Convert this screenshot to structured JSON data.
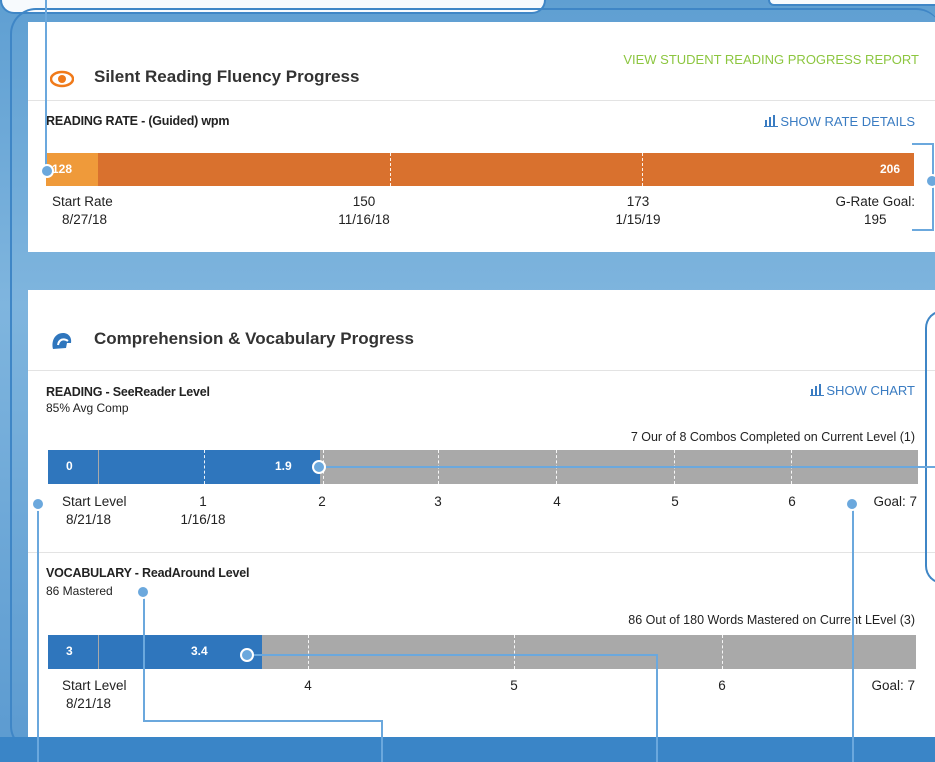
{
  "fluency": {
    "title": "Silent Reading Fluency Progress",
    "report_link": "VIEW STUDENT READING PROGRESS REPORT",
    "rate_label": "READING RATE - (Guided) wpm",
    "rate_details": "SHOW RATE DETAILS",
    "bar_start": "128",
    "bar_end": "206",
    "marks": [
      {
        "top": "Start Rate",
        "bottom": "8/27/18"
      },
      {
        "top": "150",
        "bottom": "11/16/18"
      },
      {
        "top": "173",
        "bottom": "1/15/19"
      },
      {
        "top": "G-Rate Goal:",
        "bottom": "195"
      }
    ]
  },
  "comprehension": {
    "title": "Comprehension & Vocabulary Progress",
    "reading": {
      "label": "READING - SeeReader Level",
      "note": "85% Avg Comp",
      "show_chart": "SHOW CHART",
      "combos": "7 Our of 8 Combos Completed on Current Level (1)",
      "bar_start": "0",
      "bar_value": "1.9",
      "progress_fraction": 0.27,
      "start_label": "Start Level",
      "start_date": "8/21/18",
      "ticks": [
        "1",
        "2",
        "3",
        "4",
        "5",
        "6"
      ],
      "tick1_date": "1/16/18",
      "goal": "Goal: 7"
    },
    "vocabulary": {
      "label": "VOCABULARY - ReadAround Level",
      "note": "86 Mastered",
      "words": "86 Out of 180 Words Mastered on Current LEvel (3)",
      "bar_start": "3",
      "bar_value": "3.4",
      "progress_fraction": 0.2,
      "start_label": "Start Level",
      "start_date": "8/21/18",
      "ticks": [
        "4",
        "5",
        "6"
      ],
      "goal": "Goal: 7"
    }
  },
  "colors": {
    "orange": "#d9712e",
    "orange_light": "#ef9a3a",
    "blue": "#2f76bd",
    "gray": "#a9a9a9",
    "green_link": "#8cc63f",
    "callout": "#6ba8dd"
  },
  "icons": {
    "eye": "eye-icon",
    "head": "head-icon",
    "chart": "bar-chart-icon"
  }
}
